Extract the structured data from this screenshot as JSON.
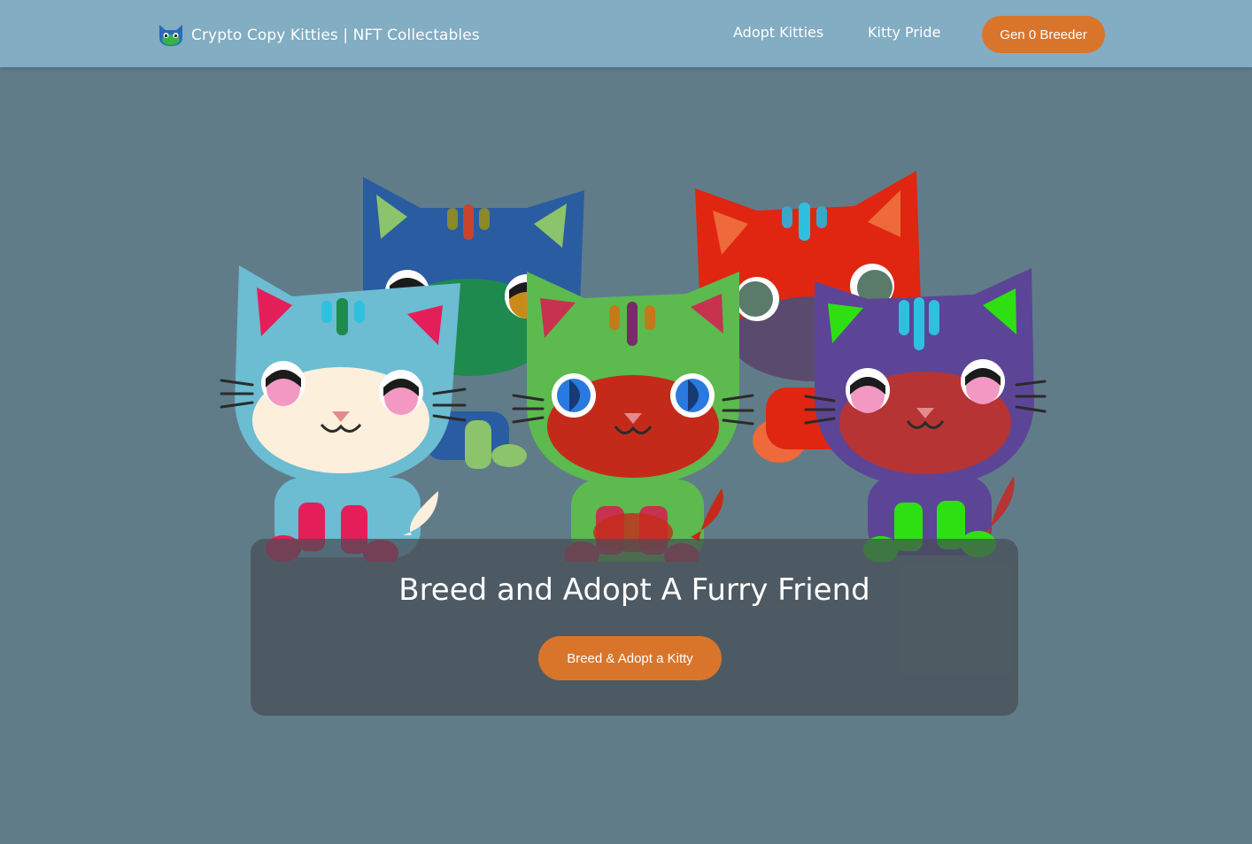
{
  "navbar": {
    "brand_title": "Crypto Copy Kitties | NFT Collectables",
    "brand_icon": "kitty-logo-icon",
    "links": [
      {
        "label": "Adopt Kitties"
      },
      {
        "label": "Kitty Pride"
      }
    ],
    "cta_label": "Gen 0 Breeder"
  },
  "hero": {
    "title": "Breed and Adopt A Furry Friend",
    "button_label": "Breed & Adopt a Kitty"
  },
  "colors": {
    "navbar_bg": "#82adc2",
    "page_bg": "#607c89",
    "accent_orange": "#d9752b",
    "panel_bg": "rgba(70,78,84,0.72)"
  },
  "kitties": [
    {
      "name": "blue-kitty",
      "body": "#2a5ca1",
      "face": "#1e8a4e",
      "accent": "#8bc46a"
    },
    {
      "name": "red-kitty",
      "body": "#e02610",
      "face": "#5a4a6e",
      "accent": "#ee6a3a"
    },
    {
      "name": "light-blue-kitty",
      "body": "#6cbcd2",
      "face": "#fcefdc",
      "accent": "#e41e58"
    },
    {
      "name": "green-kitty",
      "body": "#5cba4e",
      "face": "#c42a1a",
      "accent": "#c7324e"
    },
    {
      "name": "purple-kitty",
      "body": "#5c4596",
      "face": "#b63434",
      "accent": "#2ee012"
    }
  ]
}
